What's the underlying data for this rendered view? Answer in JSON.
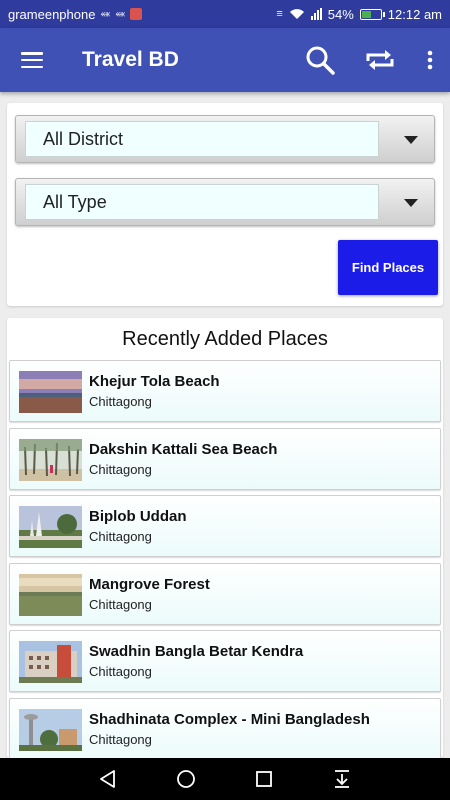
{
  "status_bar": {
    "carrier": "grameenphone",
    "battery_percent": "54%",
    "battery_level": 0.54,
    "time": "12:12 am"
  },
  "app_bar": {
    "title": "Travel BD",
    "icons": [
      "menu-icon",
      "search-icon",
      "refresh-icon",
      "more-vert-icon"
    ]
  },
  "filters": {
    "district": {
      "selected": "All District"
    },
    "type": {
      "selected": "All Type"
    },
    "find_button": "Find Places"
  },
  "recent": {
    "title": "Recently Added Places",
    "places": [
      {
        "name": "Khejur Tola Beach",
        "district": "Chittagong",
        "thumb": "beach-photo"
      },
      {
        "name": "Dakshin Kattali Sea Beach",
        "district": "Chittagong",
        "thumb": "trees-beach-photo"
      },
      {
        "name": "Biplob Uddan",
        "district": "Chittagong",
        "thumb": "park-monument-photo"
      },
      {
        "name": "Mangrove Forest",
        "district": "Chittagong",
        "thumb": "field-photo"
      },
      {
        "name": "Swadhin Bangla Betar Kendra",
        "district": "Chittagong",
        "thumb": "building-photo"
      },
      {
        "name": "Shadhinata Complex - Mini Bangladesh",
        "district": "Chittagong",
        "thumb": "tower-photo"
      }
    ]
  },
  "colors": {
    "status_bar": "#2f3b9d",
    "app_bar": "#3f51b5",
    "find_button": "#1c1ce8",
    "field_background": "#f0ffff"
  },
  "nav_bar": {
    "icons": [
      "back-icon",
      "home-icon",
      "recents-icon",
      "notification-pull-icon"
    ]
  }
}
